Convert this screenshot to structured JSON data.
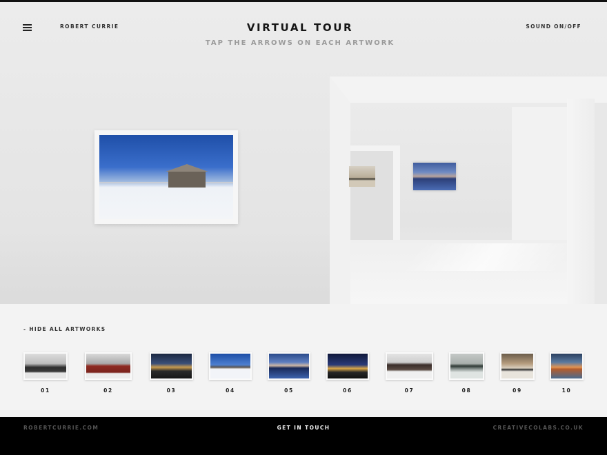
{
  "header": {
    "artist": "ROBERT CURRIE",
    "title": "VIRTUAL TOUR",
    "subtitle": "TAP THE ARROWS ON EACH ARTWORK",
    "sound_toggle": "SOUND ON/OFF",
    "menu_icon": "hamburger-menu-icon"
  },
  "strip": {
    "hide_label": "- HIDE ALL ARTWORKS",
    "thumbnails": [
      {
        "number": "01"
      },
      {
        "number": "02"
      },
      {
        "number": "03"
      },
      {
        "number": "04"
      },
      {
        "number": "05"
      },
      {
        "number": "06"
      },
      {
        "number": "07"
      },
      {
        "number": "08"
      },
      {
        "number": "09"
      },
      {
        "number": "10"
      }
    ]
  },
  "footer": {
    "website": "ROBERTCURRIE.COM",
    "contact": "GET IN TOUCH",
    "credit": "CREATIVECOLABS.CO.UK"
  },
  "colors": {
    "footer_bg": "#000000",
    "strip_bg": "#f3f3f3",
    "subtitle_gray": "#9a9a9a"
  }
}
